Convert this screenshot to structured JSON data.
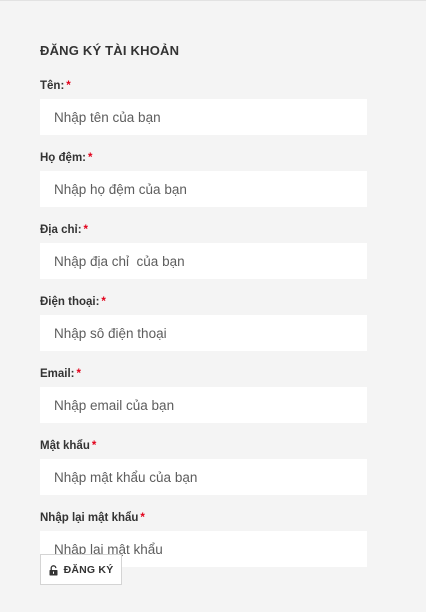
{
  "form": {
    "title": "ĐĂNG KÝ TÀI KHOẢN",
    "required_mark": "*",
    "fields": [
      {
        "label": "Tên:",
        "placeholder": "Nhập tên của bạn",
        "value": ""
      },
      {
        "label": "Họ đệm:",
        "placeholder": "Nhập họ đệm của bạn",
        "value": ""
      },
      {
        "label": "Địa chỉ:",
        "placeholder": "Nhập địa chỉ  của bạn",
        "value": ""
      },
      {
        "label": "Điện thoại:",
        "placeholder": "Nhập sô điện thoại",
        "value": ""
      },
      {
        "label": "Email:",
        "placeholder": "Nhập email của bạn",
        "value": ""
      },
      {
        "label": "Mật khẩu",
        "placeholder": "Nhập mật khẩu của bạn",
        "value": ""
      },
      {
        "label": "Nhập lại mật khẩu",
        "placeholder": "Nhập lại mật khẩu",
        "value": ""
      }
    ],
    "submit": {
      "label": "ĐĂNG KÝ",
      "icon": "unlock-icon"
    }
  },
  "colors": {
    "background": "#f4f4f4",
    "input_background": "#ffffff",
    "text": "#333333",
    "required": "#e2001a",
    "button_border": "#d4d4d4"
  }
}
